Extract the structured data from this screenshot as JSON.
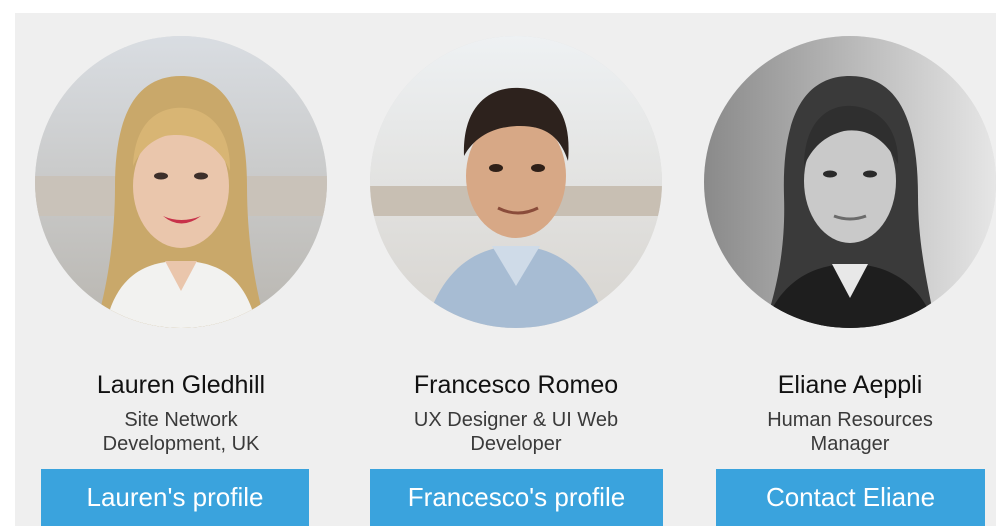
{
  "team": [
    {
      "name": "Lauren Gledhill",
      "role_line1": "Site Network",
      "role_line2": "Development, UK",
      "button_label": "Lauren's profile"
    },
    {
      "name": "Francesco Romeo",
      "role_line1": "UX Designer & UI Web",
      "role_line2": "Developer",
      "button_label": "Francesco's profile"
    },
    {
      "name": "Eliane Aeppli",
      "role_line1": "Human Resources",
      "role_line2": "Manager",
      "button_label": "Contact Eliane"
    }
  ],
  "colors": {
    "panel_background": "#efefef",
    "button_background": "#3aa3dd",
    "button_text": "#ffffff",
    "name_text": "#111111",
    "role_text": "#3a3a3a"
  }
}
